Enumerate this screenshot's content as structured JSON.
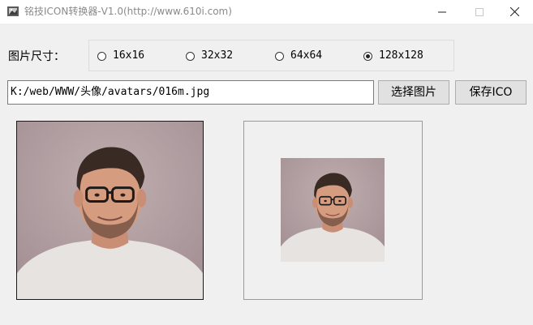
{
  "window": {
    "title": "铭技ICON转换器-V1.0(http://www.610i.com)",
    "controls": {
      "minimize": "—",
      "maximize": "☐",
      "close": "✕"
    }
  },
  "size": {
    "label": "图片尺寸：",
    "options": [
      {
        "label": "16x16",
        "selected": false
      },
      {
        "label": "32x32",
        "selected": false
      },
      {
        "label": "64x64",
        "selected": false
      },
      {
        "label": "128x128",
        "selected": true
      }
    ]
  },
  "file": {
    "path": "K:/web/WWW/头像/avatars/016m.jpg",
    "select_button": "选择图片",
    "save_button": "保存ICO"
  },
  "colors": {
    "window_bg": "#f0f0f0",
    "photo_bg": "#b3a2a4",
    "button_bg": "#e1e1e1"
  }
}
